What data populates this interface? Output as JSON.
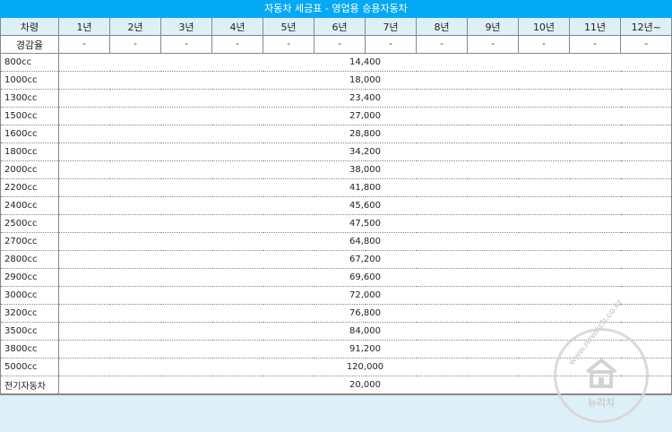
{
  "title": "자동차 세금표 - 영업용 승용자동차",
  "header": {
    "first": "차령",
    "years": [
      "1년",
      "2년",
      "3년",
      "4년",
      "5년",
      "6년",
      "7년",
      "8년",
      "9년",
      "10년",
      "11년",
      "12년~"
    ]
  },
  "rate_row": {
    "label": "경감율",
    "values": [
      "-",
      "-",
      "-",
      "-",
      "-",
      "-",
      "-",
      "-",
      "-",
      "-",
      "-",
      "-"
    ]
  },
  "rows": [
    {
      "label": "800cc",
      "amount": "14,400"
    },
    {
      "label": "1000cc",
      "amount": "18,000"
    },
    {
      "label": "1300cc",
      "amount": "23,400"
    },
    {
      "label": "1500cc",
      "amount": "27,000"
    },
    {
      "label": "1600cc",
      "amount": "28,800"
    },
    {
      "label": "1800cc",
      "amount": "34,200"
    },
    {
      "label": "2000cc",
      "amount": "38,000"
    },
    {
      "label": "2200cc",
      "amount": "41,800"
    },
    {
      "label": "2400cc",
      "amount": "45,600"
    },
    {
      "label": "2500cc",
      "amount": "47,500"
    },
    {
      "label": "2700cc",
      "amount": "64,800"
    },
    {
      "label": "2800cc",
      "amount": "67,200"
    },
    {
      "label": "2900cc",
      "amount": "69,600"
    },
    {
      "label": "3000cc",
      "amount": "72,000"
    },
    {
      "label": "3200cc",
      "amount": "76,800"
    },
    {
      "label": "3500cc",
      "amount": "84,000"
    },
    {
      "label": "3800cc",
      "amount": "91,200"
    },
    {
      "label": "5000cc",
      "amount": "120,000"
    },
    {
      "label": "전기자동차",
      "amount": "20,000"
    }
  ],
  "watermark": {
    "url": "www.newrich.co.kr",
    "label": "뉴리치",
    "icon": "house-icon"
  },
  "colors": {
    "title_bar": "#03a9f4",
    "header_bg": "#def0f7"
  }
}
